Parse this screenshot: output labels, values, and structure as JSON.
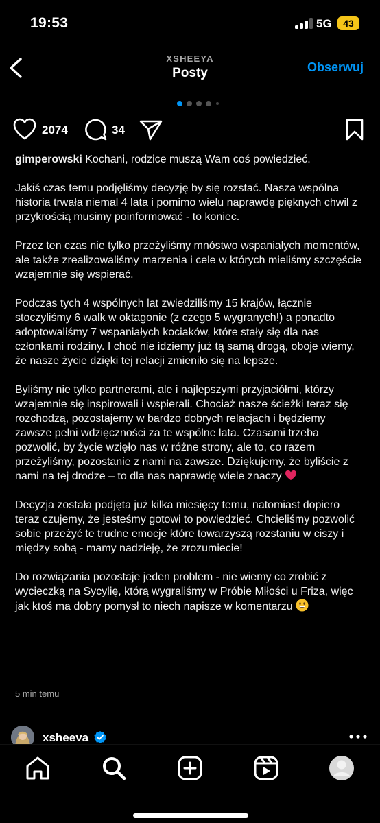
{
  "status_bar": {
    "time": "19:53",
    "network": "5G",
    "battery": "43"
  },
  "header": {
    "username": "XSHEEYA",
    "title": "Posty",
    "follow_label": "Obserwuj"
  },
  "post": {
    "likes": "2074",
    "comments": "34",
    "carousel": {
      "count": 5,
      "active_index": 0
    },
    "caption_author": "gimperowski",
    "caption_first_line": " Kochani, rodzice muszą Wam coś powiedzieć.",
    "paragraphs": [
      "Jakiś czas temu podjęliśmy decyzję by się rozstać. Nasza wspólna historia trwała niemal 4 lata i pomimo wielu naprawdę pięknych chwil z przykrością musimy poinformować - to koniec.",
      "Przez ten czas nie tylko przeżyliśmy mnóstwo wspaniałych momentów, ale także zrealizowaliśmy marzenia i cele w których mieliśmy szczęście wzajemnie się wspierać.",
      "Podczas tych 4 wspólnych lat zwiedziliśmy 15 krajów, łącznie stoczyliśmy 6 walk w oktagonie (z czego 5 wygranych!) a ponadto adoptowaliśmy 7 wspaniałych kociaków, które stały się dla nas członkami rodziny. I choć nie idziemy już tą samą drogą, oboje wiemy, że nasze życie dzięki tej relacji zmieniło się na lepsze.",
      "Byliśmy nie tylko partnerami, ale i najlepszymi przyjaciółmi, którzy wzajemnie się inspirowali i wspierali. Chociaż nasze ścieżki teraz się rozchodzą, pozostajemy w bardzo dobrych relacjach i będziemy zawsze pełni wdzięczności za te wspólne lata. Czasami trzeba pozwolić, by życie wzięło nas w różne strony, ale to, co razem przeżyliśmy, pozostanie z nami na zawsze. Dziękujemy, że byliście z nami na tej drodze – to dla nas naprawdę wiele znaczy",
      "Decyzja została podjęta już kilka miesięcy temu, natomiast dopiero teraz czujemy, że jesteśmy gotowi to powiedzieć. Chcieliśmy pozwolić sobie przeżyć te trudne emocje które towarzyszą rozstaniu w ciszy i między sobą - mamy nadzieję, że zrozumiecie!",
      "Do rozwiązania pozostaje jeden problem - nie wiemy co zrobić z wycieczką na Sycylię, którą wygraliśmy w Próbie Miłości u Friza, więc jak ktoś ma dobry pomysł to niech napisze w komentarzu"
    ],
    "timestamp": "5 min temu"
  },
  "next_post": {
    "username": "xsheeva",
    "verified": true
  },
  "icons": {
    "back": "chevron-left-icon",
    "heart": "heart-icon",
    "comment": "comment-icon",
    "share": "paper-plane-icon",
    "save": "bookmark-icon",
    "red_heart_emoji": "red-heart-emoji",
    "grin_emoji": "grinning-face-emoji",
    "verified": "verified-badge-icon",
    "more": "more-icon",
    "tabs": [
      "home-icon",
      "search-icon",
      "create-icon",
      "reels-icon",
      "profile-icon"
    ]
  },
  "colors": {
    "background": "#000000",
    "text": "#f5f5f5",
    "secondary_text": "#a8a8a8",
    "accent": "#0095f6",
    "battery": "#f5c518",
    "heart_emoji": "#e0245e",
    "verified": "#0095f6"
  }
}
